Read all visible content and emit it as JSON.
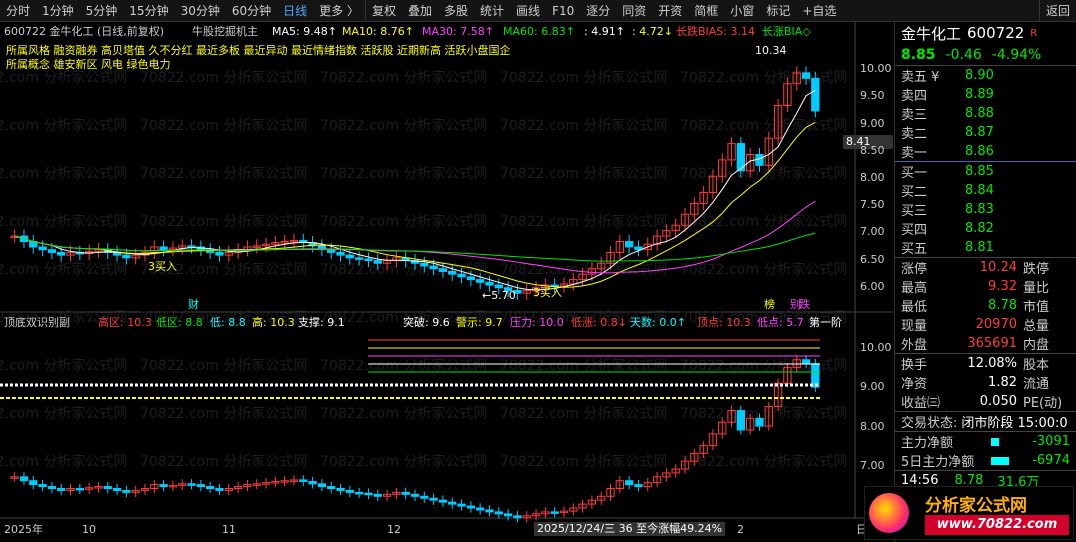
{
  "toolbar": {
    "items": [
      "分时",
      "1分钟",
      "5分钟",
      "15分钟",
      "30分钟",
      "60分钟",
      "日线",
      "更多 〉",
      "复权",
      "叠加",
      "多股",
      "统计",
      "画线",
      "F10",
      "逐分",
      "同资",
      "开资",
      "简框",
      "小窗",
      "标记",
      "+自选",
      "返回"
    ]
  },
  "stock": {
    "name": "金牛化工",
    "code": "600722",
    "price": "8.85",
    "change": "-0.46",
    "pct": "-4.94%",
    "tag": "R"
  },
  "main_header": {
    "title": "600722 金牛化工 (日线,前复权)",
    "indicator": "牛股挖掘机主",
    "ma5": "MA5: 9.48↑",
    "ma10": "MA10: 8.76↑",
    "ma30": "MA30: 7.58↑",
    "ma60": "MA60: 6.83↑",
    "v1": ": 4.91↑",
    "v2": ": 4.72↓",
    "bias1": "长跌BIAS: 3.14",
    "bias2": "长涨BIA◇"
  },
  "concepts": {
    "line1": "所属风格 融资融券 高贝塔值 久不分红 最近多板 最近异动 最近情绪指数 活跃股 近期新高 活跃小盘国企",
    "line2": "所属概念 雄安新区 风电 绿色电力"
  },
  "annotations": {
    "buy1": "3买入",
    "buy2": "3买入",
    "low": "←5.70",
    "high": "10.34",
    "cai": "财",
    "bang": "榜",
    "bie": "别",
    "die": "跌",
    "crosshair": "8.41"
  },
  "price_axis": [
    "10.00",
    "9.50",
    "9.00",
    "8.50",
    "8.00",
    "7.50",
    "7.00",
    "6.50",
    "6.00"
  ],
  "lower_header": {
    "title": "顶底双识别副",
    "gao": "高区: 10.3",
    "dqu": "低区: 8.8",
    "di": "低: 8.8",
    "gao2": "高: 10.3",
    "zhicheng": "支撑: 9.1",
    "tupo": "突破: 9.6",
    "jingshi": "警示: 9.7",
    "yali": "压力: 10.0",
    "dizhang": "低涨: 0.8↓",
    "tianshu": "天数: 0.0↑",
    "dingdian": "顶点: 10.3",
    "didian": "低点: 5.7",
    "diyi": "第一阶"
  },
  "lower_axis": [
    "10.00",
    "9.00",
    "8.00",
    "7.00"
  ],
  "date_axis": {
    "y2025": "2025年",
    "m10": "10",
    "m11": "11",
    "m12": "12",
    "tip": "2025/12/24/三  36  至今涨幅49.24%",
    "m2": "2",
    "ri": "日"
  },
  "orderbook": {
    "sells": [
      {
        "l": "卖五 ¥",
        "p": "8.90"
      },
      {
        "l": "卖四",
        "p": "8.89"
      },
      {
        "l": "卖三",
        "p": "8.88"
      },
      {
        "l": "卖二",
        "p": "8.87"
      },
      {
        "l": "卖一",
        "p": "8.86"
      }
    ],
    "buys": [
      {
        "l": "买一",
        "p": "8.85"
      },
      {
        "l": "买二",
        "p": "8.84"
      },
      {
        "l": "买三",
        "p": "8.83"
      },
      {
        "l": "买四",
        "p": "8.82"
      },
      {
        "l": "买五",
        "p": "8.81"
      }
    ]
  },
  "stats": [
    {
      "a": "涨停",
      "av": "10.24",
      "b": "跌停"
    },
    {
      "a": "最高",
      "av": "9.32",
      "b": "量比"
    },
    {
      "a": "最低",
      "av": "8.78",
      "b": "市值"
    },
    {
      "a": "现量",
      "av": "20970",
      "b": "总量"
    },
    {
      "a": "外盘",
      "av": "365691",
      "b": "内盘"
    }
  ],
  "stats2": [
    {
      "a": "换手",
      "av": "12.08%",
      "b": "股本"
    },
    {
      "a": "净资",
      "av": "1.82",
      "b": "流通"
    },
    {
      "a": "收益㈢",
      "av": "0.050",
      "b": "PE(动)"
    }
  ],
  "status": {
    "label": "交易状态:",
    "value": "闭市阶段 15:00:0"
  },
  "flow": [
    {
      "l": "主力净额",
      "v": "-3091"
    },
    {
      "l": "5日主力净额",
      "v": "-6974"
    }
  ],
  "tick": {
    "time": "14:56",
    "price": "8.78",
    "vol": "31.6万"
  },
  "logo": {
    "text": "分析家公式网",
    "url": "www.70822.com"
  },
  "watermark": "70822.com 分析家公式网"
}
